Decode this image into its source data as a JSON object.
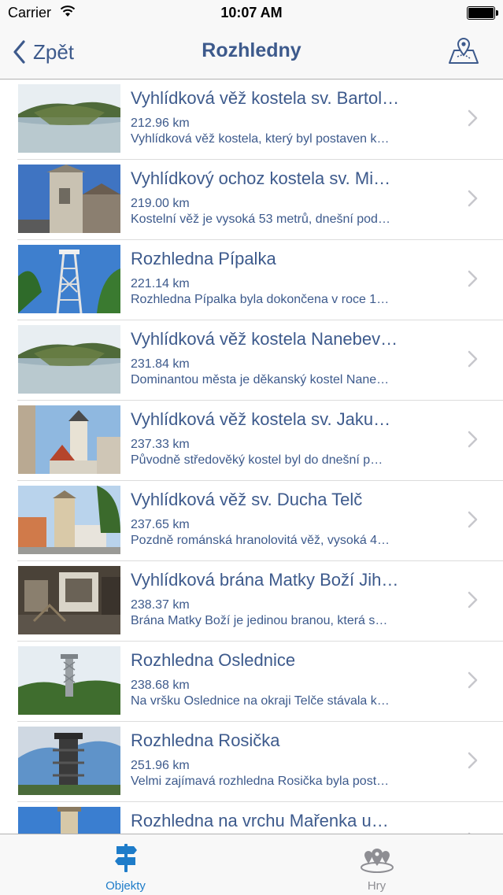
{
  "status_bar": {
    "carrier": "Carrier",
    "time": "10:07 AM"
  },
  "nav": {
    "back_label": "Zpět",
    "title": "Rozhledny",
    "map_icon": "map-pin-icon"
  },
  "list": [
    {
      "title": "Vyhlídková věž kostela sv. Bartol…",
      "distance": "212.96 km",
      "description": "Vyhlídková věž kostela, který byl postaven k…"
    },
    {
      "title": "Vyhlídkový ochoz kostela sv. Mi…",
      "distance": "219.00 km",
      "description": "Kostelní věž je vysoká 53 metrů, dnešní pod…"
    },
    {
      "title": "Rozhledna Pípalka",
      "distance": "221.14 km",
      "description": "Rozhledna Pípalka byla dokončena v roce 1…"
    },
    {
      "title": "Vyhlídková věž kostela Nanebev…",
      "distance": "231.84 km",
      "description": "Dominantou města je děkanský kostel Nane…"
    },
    {
      "title": "Vyhlídková věž kostela sv. Jaku…",
      "distance": "237.33 km",
      "description": "Původně středověký kostel byl do dnešní p…"
    },
    {
      "title": "Vyhlídková věž sv. Ducha Telč",
      "distance": "237.65 km",
      "description": "Pozdně románská hranolovitá věž, vysoká 4…"
    },
    {
      "title": "Vyhlídková brána Matky Boží Jih…",
      "distance": "238.37 km",
      "description": "Brána Matky Boží je jedinou branou, která s…"
    },
    {
      "title": "Rozhledna Oslednice",
      "distance": "238.68 km",
      "description": "Na vršku Oslednice na okraji Telče stávala k…"
    },
    {
      "title": "Rozhledna Rosička",
      "distance": "251.96 km",
      "description": "Velmi zajímavá rozhledna Rosička byla post…"
    },
    {
      "title": "Rozhledna na vrchu Mařenka u…",
      "distance": "",
      "description": ""
    }
  ],
  "tabs": [
    {
      "label": "Objekty",
      "icon": "signpost-icon",
      "active": true
    },
    {
      "label": "Hry",
      "icon": "map-pins-icon",
      "active": false
    }
  ],
  "colors": {
    "accent": "#3d5a8c",
    "tab_active": "#1e7cc9",
    "tab_inactive": "#8e8e93"
  }
}
